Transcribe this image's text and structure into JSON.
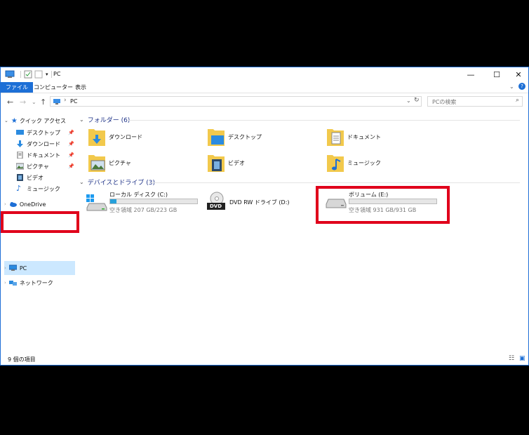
{
  "window": {
    "title": "PC"
  },
  "ribbon": {
    "tabs": [
      "ファイル",
      "コンピューター",
      "表示"
    ]
  },
  "address": {
    "path": "PC",
    "chevron": "›"
  },
  "search": {
    "placeholder": "PCの検索"
  },
  "nav": {
    "quick_access": "クイック アクセス",
    "items": [
      "デスクトップ",
      "ダウンロード",
      "ドキュメント",
      "ピクチャ",
      "ビデオ",
      "ミュージック"
    ],
    "onedrive": "OneDrive",
    "pc": "PC",
    "network": "ネットワーク"
  },
  "folders": {
    "header": "フォルダー (6)",
    "items": [
      "ダウンロード",
      "デスクトップ",
      "ドキュメント",
      "ピクチャ",
      "ビデオ",
      "ミュージック"
    ]
  },
  "drives": {
    "header": "デバイスとドライブ (3)",
    "items": [
      {
        "name": "ローカル ディスク (C:)",
        "free": "空き領域 207 GB/223 GB",
        "used_fraction": 0.07
      },
      {
        "name": "DVD RW ドライブ (D:)",
        "label": "DVD"
      },
      {
        "name": "ボリューム (E:)",
        "free": "空き領域 931 GB/931 GB",
        "used_fraction": 0.0
      }
    ]
  },
  "status": {
    "count": "9 個の項目"
  },
  "colors": {
    "accent": "#1d6fd6",
    "highlight": "#e0001b",
    "selection": "#cce8ff",
    "folder": "#f2c94c"
  }
}
